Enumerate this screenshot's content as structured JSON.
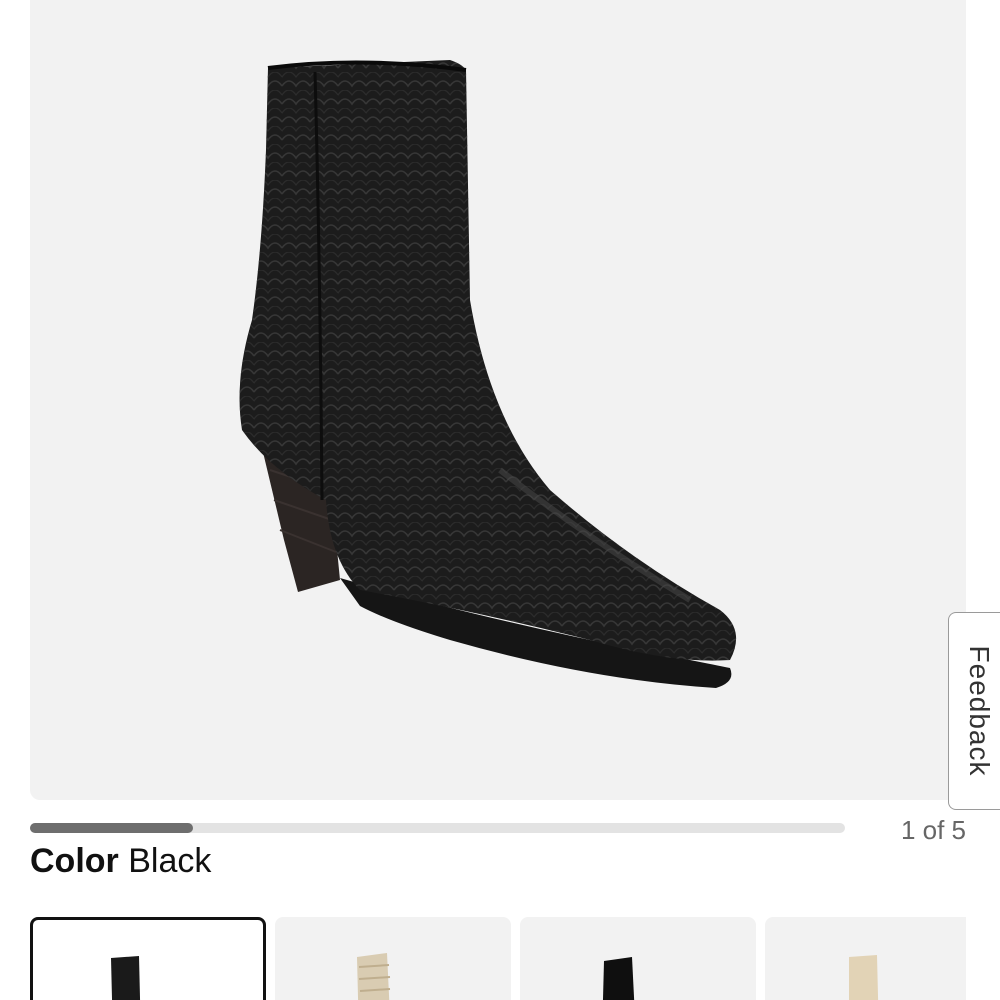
{
  "product": {
    "image_alt": "Black snake-embossed pointed-toe western ankle boot"
  },
  "feedback_tab": {
    "label": "Feedback"
  },
  "gallery": {
    "progress_fraction": 0.2,
    "counter": "1 of 5"
  },
  "color": {
    "label": "Color",
    "value": "Black"
  },
  "swatches": [
    {
      "name": "black",
      "selected": true
    },
    {
      "name": "natural-snake",
      "selected": false
    },
    {
      "name": "black-smooth",
      "selected": false
    },
    {
      "name": "bone",
      "selected": false
    }
  ],
  "colors": {
    "accent": "#111111",
    "track": "#e3e3e3",
    "fill": "#6e6e6e",
    "image_bg": "#f2f2f2"
  }
}
